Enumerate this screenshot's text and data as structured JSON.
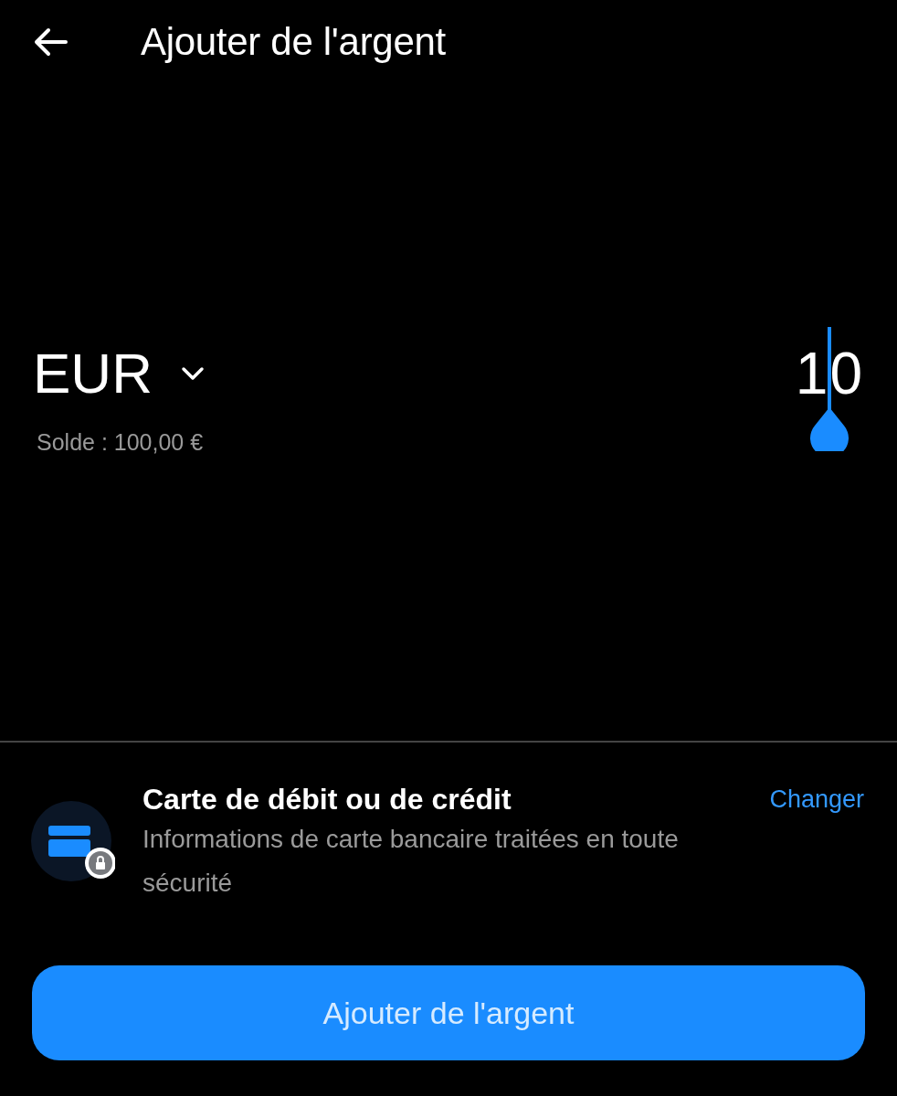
{
  "header": {
    "title": "Ajouter de l'argent"
  },
  "amount_entry": {
    "currency": "EUR",
    "balance": "Solde : 100,00 €",
    "amount": "10"
  },
  "payment_method": {
    "title": "Carte de débit ou de crédit",
    "description": "Informations de carte bancaire traitées en toute sécurité",
    "action": "Changer"
  },
  "submit_button": {
    "label": "Ajouter de l'argent",
    "disabled": false
  }
}
